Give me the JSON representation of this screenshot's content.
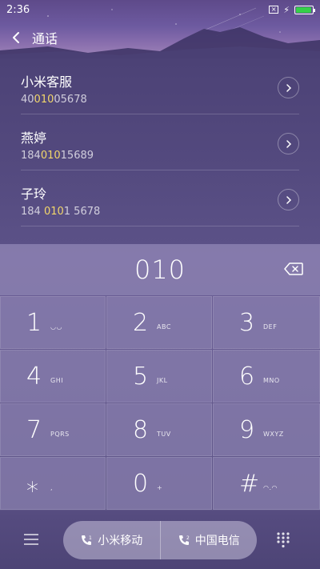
{
  "status_bar": {
    "time": "2:36",
    "sim_label": "×",
    "charging": "⚡",
    "battery_percent": 95
  },
  "header": {
    "title": "通话"
  },
  "contacts": [
    {
      "name": "小米客服",
      "number_parts": [
        "40",
        "010",
        "05678"
      ]
    },
    {
      "name": "燕婷",
      "number_parts": [
        "184",
        "010",
        "15689"
      ]
    },
    {
      "name": "子玲",
      "number_parts": [
        "184 ",
        "010",
        "1 5678"
      ]
    }
  ],
  "dial": {
    "number": "010"
  },
  "keypad": [
    {
      "digit": "1",
      "letters": "◡◡"
    },
    {
      "digit": "2",
      "letters": "ABC"
    },
    {
      "digit": "3",
      "letters": "DEF"
    },
    {
      "digit": "4",
      "letters": "GHI"
    },
    {
      "digit": "5",
      "letters": "JKL"
    },
    {
      "digit": "6",
      "letters": "MNO"
    },
    {
      "digit": "7",
      "letters": "PQRS"
    },
    {
      "digit": "8",
      "letters": "TUV"
    },
    {
      "digit": "9",
      "letters": "WXYZ"
    },
    {
      "digit": "⁎",
      "letters": ","
    },
    {
      "digit": "0",
      "letters": "+"
    },
    {
      "digit": "#",
      "letters": "◠.◠"
    }
  ],
  "call_buttons": {
    "sim1": {
      "label": "小米移动",
      "slot": "1"
    },
    "sim2": {
      "label": "中国电信",
      "slot": "2"
    }
  },
  "colors": {
    "highlight": "#f3d76a",
    "battery": "#35d049"
  }
}
